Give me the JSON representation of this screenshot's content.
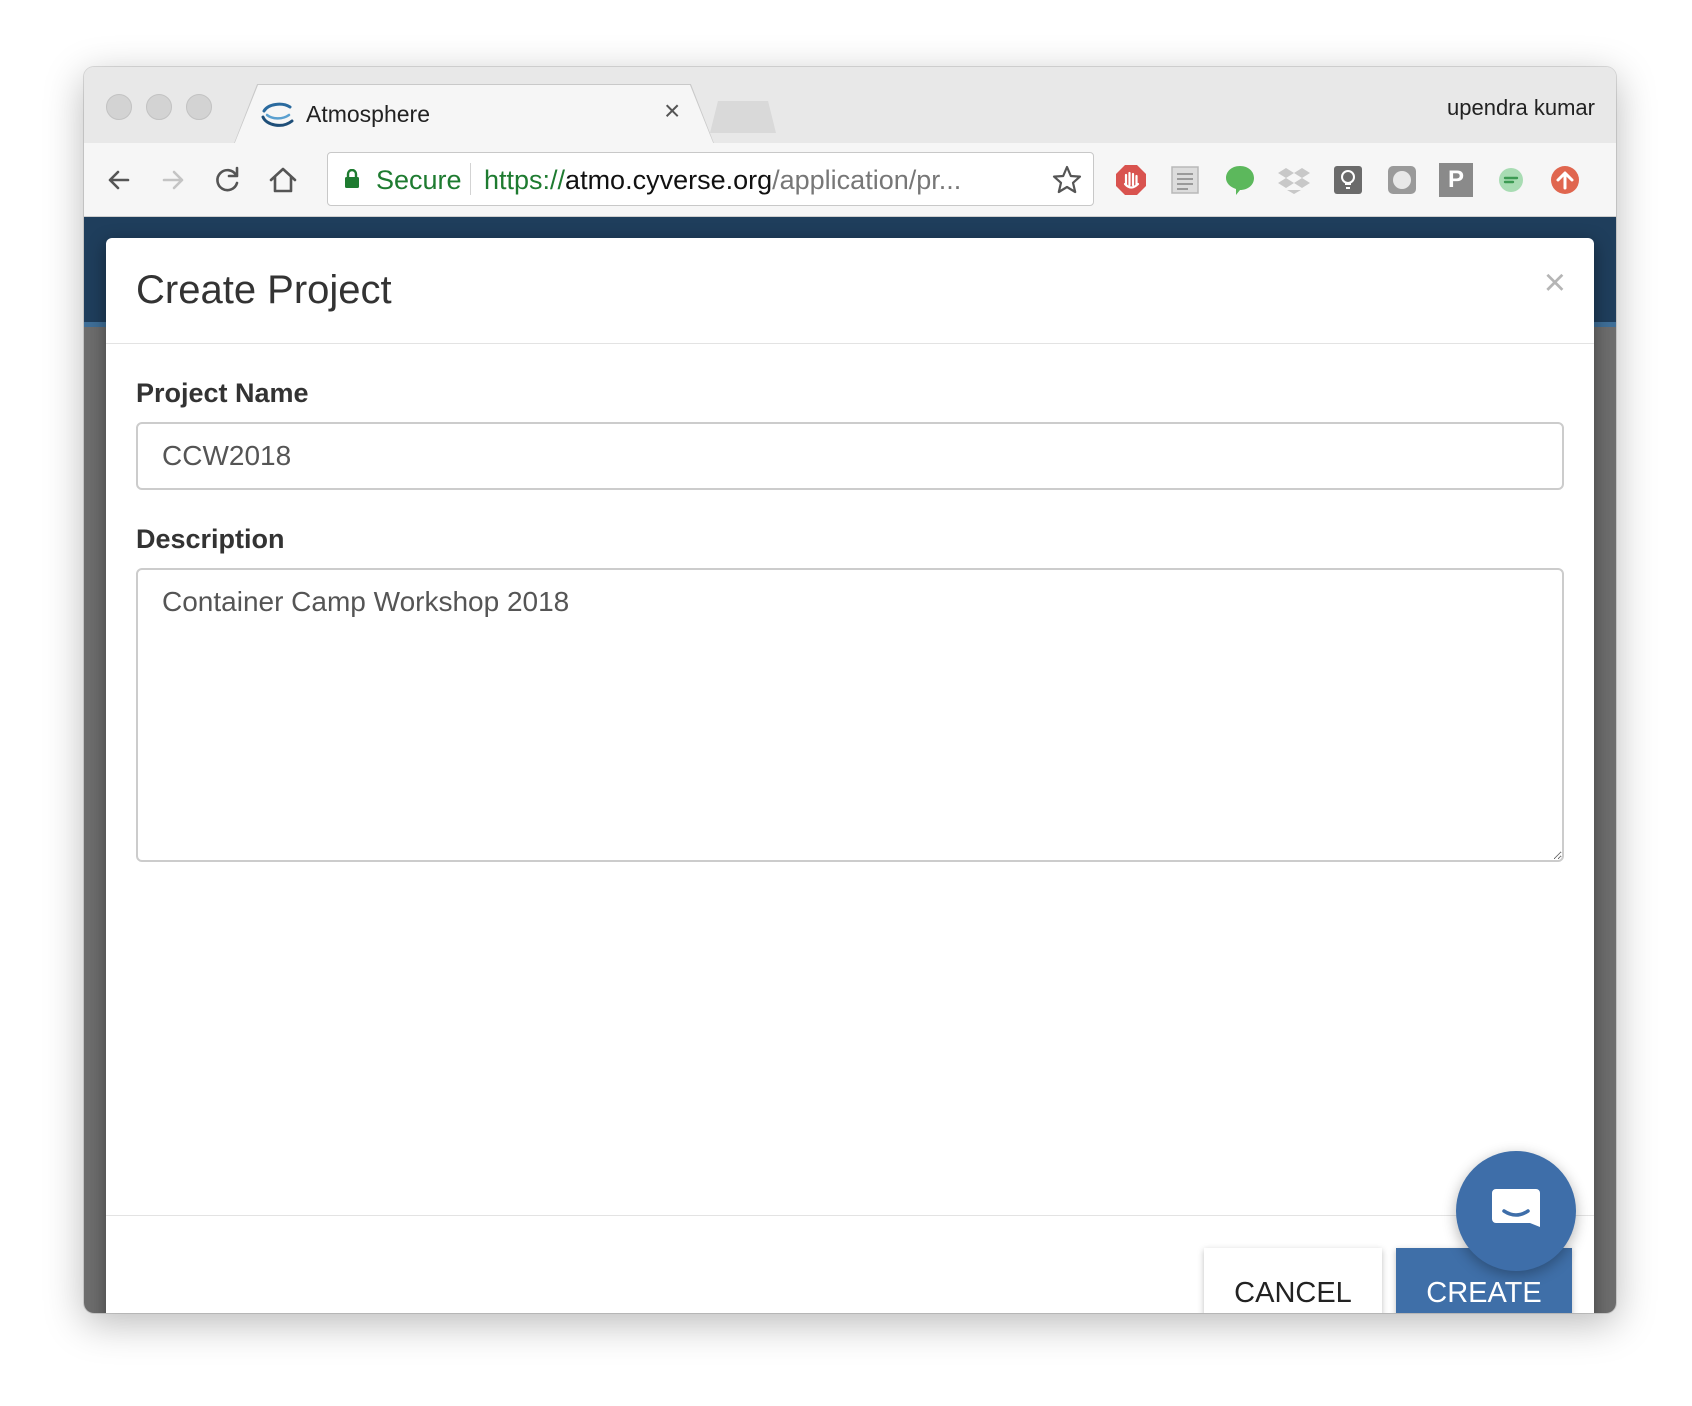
{
  "browser": {
    "tab": {
      "title": "Atmosphere",
      "icon": "atmosphere-logo-icon",
      "close_symbol": "×"
    },
    "profile_name": "upendra kumar",
    "address_bar": {
      "security_label": "Secure",
      "url_scheme": "https://",
      "url_host": "atmo.cyverse.org",
      "url_path": "/application/pr..."
    },
    "extensions": [
      "adblock-icon",
      "reader-icon",
      "chat-bubble-icon",
      "dropbox-icon",
      "lightbulb-icon",
      "note-icon",
      "p-badge-icon",
      "grammar-icon",
      "upload-icon"
    ],
    "extension_p_letter": "P"
  },
  "modal": {
    "title": "Create Project",
    "close_symbol": "×",
    "project_name": {
      "label": "Project Name",
      "value": "CCW2018"
    },
    "description": {
      "label": "Description",
      "value": "Container Camp Workshop 2018"
    },
    "cancel_label": "CANCEL",
    "create_label": "CREATE"
  },
  "colors": {
    "secure_green": "#1e7b30",
    "header_navy": "#1f3e5c",
    "create_blue": "#3f6fa8",
    "chat_blue": "#3e6ea9"
  }
}
